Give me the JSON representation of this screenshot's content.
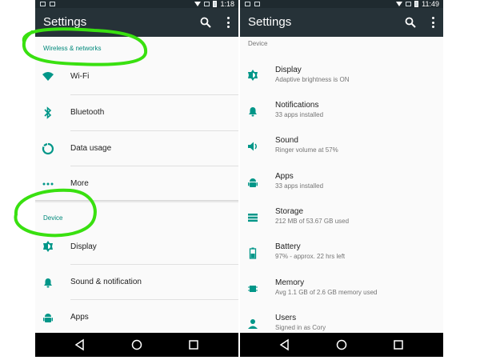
{
  "colors": {
    "appbar": "#263238",
    "statusbar": "#1f2a2f",
    "accent": "#00897b",
    "icon": "#009688",
    "highlight": "#39e010",
    "navbar": "#000000"
  },
  "left": {
    "status": {
      "time": "1:18"
    },
    "title": "Settings",
    "sections": [
      {
        "header": "Wireless & networks",
        "items": [
          {
            "icon": "wifi-icon",
            "label": "Wi-Fi"
          },
          {
            "icon": "bluetooth-icon",
            "label": "Bluetooth"
          },
          {
            "icon": "data-usage-icon",
            "label": "Data usage"
          },
          {
            "icon": "more-dots-icon",
            "label": "More"
          }
        ]
      },
      {
        "header": "Device",
        "items": [
          {
            "icon": "brightness-icon",
            "label": "Display"
          },
          {
            "icon": "bell-icon",
            "label": "Sound & notification"
          },
          {
            "icon": "android-icon",
            "label": "Apps"
          }
        ]
      }
    ]
  },
  "right": {
    "status": {
      "time": "11:49"
    },
    "title": "Settings",
    "section_header": "Device",
    "items": [
      {
        "icon": "brightness-icon",
        "label": "Display",
        "sub": "Adaptive brightness is ON"
      },
      {
        "icon": "bell-icon",
        "label": "Notifications",
        "sub": "33 apps installed"
      },
      {
        "icon": "volume-icon",
        "label": "Sound",
        "sub": "Ringer volume at 57%"
      },
      {
        "icon": "android-icon",
        "label": "Apps",
        "sub": "33 apps installed"
      },
      {
        "icon": "storage-icon",
        "label": "Storage",
        "sub": "212 MB of 53.67 GB used"
      },
      {
        "icon": "battery-icon",
        "label": "Battery",
        "sub": "97% - approx. 22 hrs left"
      },
      {
        "icon": "memory-icon",
        "label": "Memory",
        "sub": "Avg 1.1 GB of 2.6 GB memory used"
      },
      {
        "icon": "person-icon",
        "label": "Users",
        "sub": "Signed in as Cory"
      }
    ]
  },
  "navbar": [
    "back-icon",
    "home-icon",
    "recents-icon"
  ]
}
